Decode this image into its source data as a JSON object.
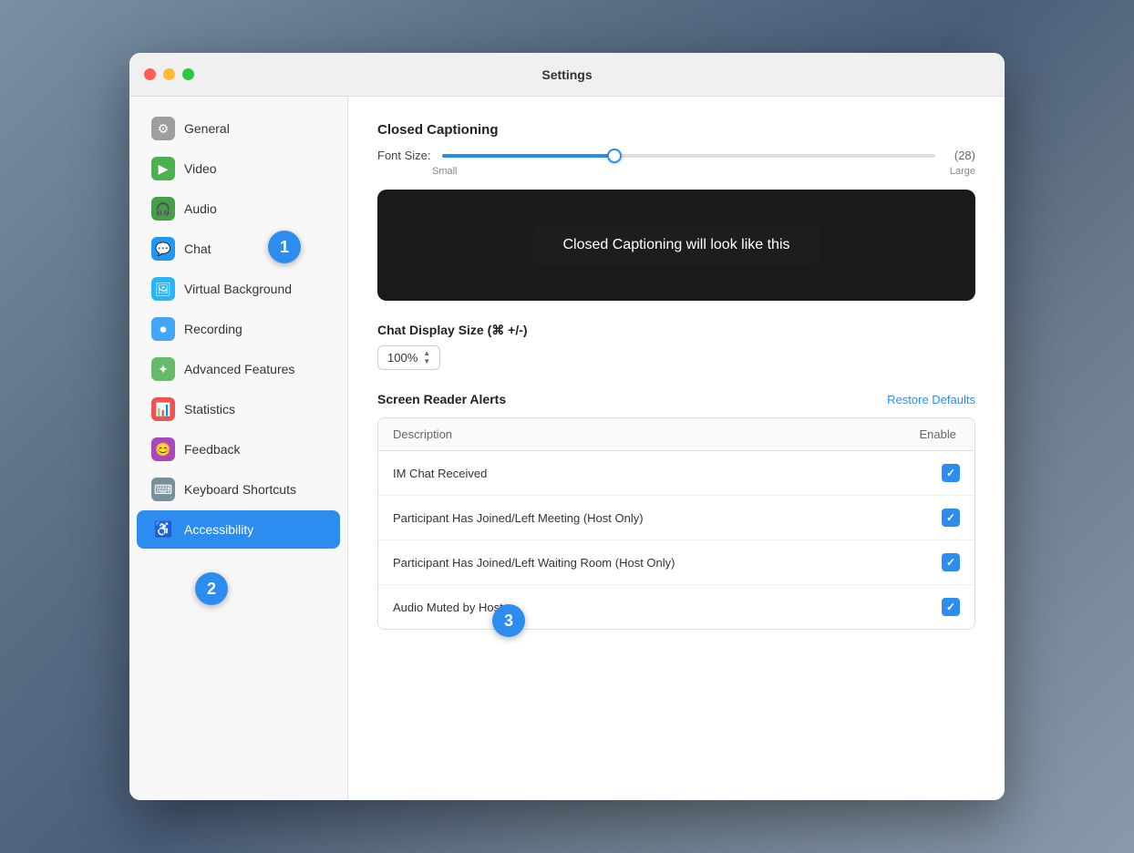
{
  "window": {
    "title": "Settings"
  },
  "sidebar": {
    "items": [
      {
        "id": "general",
        "label": "General",
        "icon": "⚙",
        "iconClass": "icon-general"
      },
      {
        "id": "video",
        "label": "Video",
        "icon": "▶",
        "iconClass": "icon-video"
      },
      {
        "id": "audio",
        "label": "Audio",
        "icon": "🎧",
        "iconClass": "icon-audio"
      },
      {
        "id": "chat",
        "label": "Chat",
        "icon": "💬",
        "iconClass": "icon-chat"
      },
      {
        "id": "virtual-background",
        "label": "Virtual Background",
        "icon": "🖼",
        "iconClass": "icon-vbg"
      },
      {
        "id": "recording",
        "label": "Recording",
        "icon": "⏺",
        "iconClass": "icon-recording"
      },
      {
        "id": "advanced-features",
        "label": "Advanced Features",
        "icon": "✦",
        "iconClass": "icon-advanced"
      },
      {
        "id": "statistics",
        "label": "Statistics",
        "icon": "📊",
        "iconClass": "icon-statistics"
      },
      {
        "id": "feedback",
        "label": "Feedback",
        "icon": "😊",
        "iconClass": "icon-feedback"
      },
      {
        "id": "keyboard-shortcuts",
        "label": "Keyboard Shortcuts",
        "icon": "⌨",
        "iconClass": "icon-keyboard"
      },
      {
        "id": "accessibility",
        "label": "Accessibility",
        "icon": "♿",
        "iconClass": "icon-accessibility",
        "active": true
      }
    ]
  },
  "main": {
    "closed_captioning": {
      "title": "Closed Captioning",
      "font_size_label": "Font Size:",
      "font_size_value": "(28)",
      "slider_small": "Small",
      "slider_large": "Large",
      "preview_text": "Closed Captioning will look like this"
    },
    "chat_display": {
      "label": "Chat Display Size (⌘ +/-)",
      "value": "100%"
    },
    "screen_reader": {
      "title": "Screen Reader Alerts",
      "restore_label": "Restore Defaults",
      "col_description": "Description",
      "col_enable": "Enable",
      "rows": [
        {
          "desc": "IM Chat Received",
          "checked": true
        },
        {
          "desc": "Participant Has Joined/Left Meeting (Host Only)",
          "checked": true
        },
        {
          "desc": "Participant Has Joined/Left Waiting Room (Host Only)",
          "checked": true
        },
        {
          "desc": "Audio Muted by Host",
          "checked": true
        }
      ]
    }
  },
  "annotations": {
    "bubble1": "1",
    "bubble2": "2",
    "bubble3": "3"
  }
}
